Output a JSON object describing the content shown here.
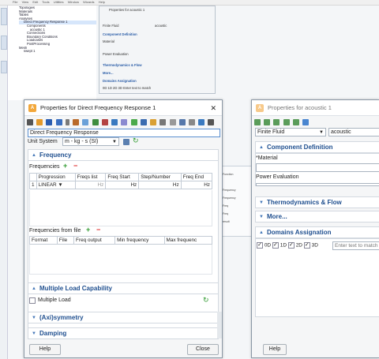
{
  "bg": {
    "menu": [
      "File",
      "View",
      "Edit",
      "Tools",
      "Utilities",
      "Window",
      "Wizards",
      "Help"
    ],
    "tree": [
      "Topologies",
      "Materials",
      "Tables",
      "Analyses",
      "Direct Frequency Response 1",
      "Components",
      "acoustic 1",
      "Connections",
      "Boundary Conditions",
      "Loadcases",
      "PostProcessing",
      "Mesh",
      "swept 1"
    ],
    "small_title": "Properties for acoustic 1",
    "small_rows": [
      "Finite Fluid",
      "acoustic",
      "Component Definition",
      "Material",
      "Power Evaluation",
      "Thermodynamics & Flow",
      "More...",
      "Domains Assignation",
      "0D  1D  2D  3D  Enter text to match"
    ]
  },
  "dlg1": {
    "title": "Properties for Direct Frequency Response 1",
    "close": "✕",
    "name_value": "Direct Frequency Response",
    "unit_label": "Unit System",
    "unit_value": "m - kg - s (SI)",
    "freq_section": "Frequency",
    "frequencies_label": "Frequencies",
    "cols": [
      "Progression",
      "Freqs list",
      "Freq Start",
      "Step/Number",
      "Freq End"
    ],
    "row": {
      "index": "1",
      "progression": "LINEAR",
      "unit1": "Hz",
      "unit2": "Hz",
      "unit3": "Hz",
      "unit4": "Hz"
    },
    "from_file_label": "Frequencies from file",
    "file_cols": [
      "Format",
      "File",
      "Freq output",
      "Min frequency",
      "Max frequenc"
    ],
    "multiload_section": "Multiple Load Capability",
    "multiload_label": "Multiple Load",
    "axi_section": "(Axi)symmetry",
    "damping_section": "Damping",
    "help": "Help",
    "closebtn": "Close"
  },
  "dlg2": {
    "title": "Properties for acoustic 1",
    "type_value": "Finite Fluid",
    "name_value": "acoustic",
    "comp_section": "Component Definition",
    "material_label": "*Material",
    "power_label": "Power Evaluation",
    "thermo_section": "Thermodynamics & Flow",
    "more_section": "More...",
    "domains_section": "Domains Assignation",
    "dims": [
      "0D",
      "1D",
      "2D",
      "3D"
    ],
    "search_placeholder": "Enter text to match",
    "help": "Help"
  }
}
